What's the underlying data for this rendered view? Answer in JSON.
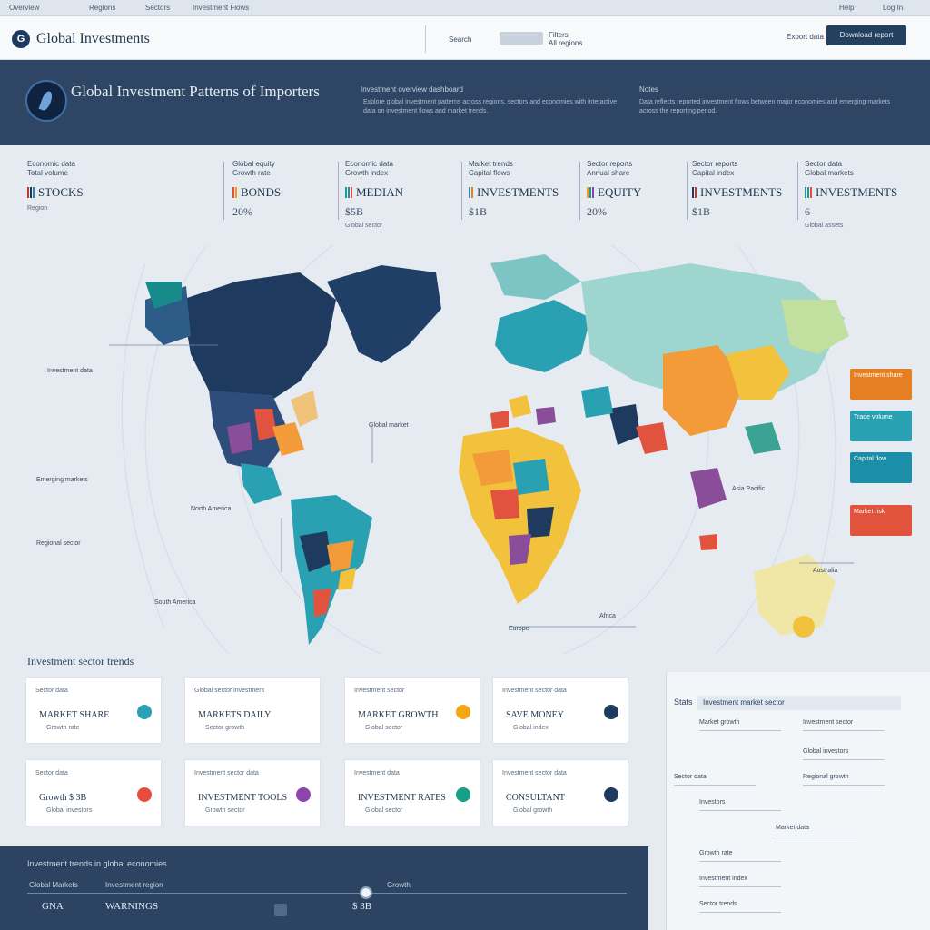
{
  "topbar": {
    "items": [
      "Overview",
      "Regions",
      "Sectors",
      "Investment Flows"
    ],
    "right": [
      "Help",
      "Log In"
    ]
  },
  "header": {
    "brand": "Global Investments",
    "nav_label": "Search",
    "field_label": "Filters",
    "field_sub": "All regions",
    "right_label": "Export data",
    "button": "Download report"
  },
  "hero": {
    "title": "Global Investment Patterns of Importers",
    "subtitle": "Investment overview dashboard",
    "description": "Explore global investment patterns across regions, sectors and economies with interactive data on investment flows and market trends.",
    "side_title": "Notes",
    "side_description": "Data reflects reported investment flows between major economies and emerging markets across the reporting period."
  },
  "stats": [
    {
      "label": "Economic data",
      "sub": "Total volume",
      "big": "STOCKS",
      "num": "",
      "small": "Region",
      "bars": [
        "#c0392b",
        "#1e3a5f",
        "#2e86ab"
      ]
    },
    {
      "label": "Global equity",
      "sub": "Growth rate",
      "big": "BONDS",
      "num": "20%",
      "small": "",
      "bars": [
        "#e74c3c",
        "#f39c12"
      ]
    },
    {
      "label": "Economic data",
      "sub": "Growth index",
      "big": "MEDIAN",
      "num": "$5B",
      "small": "Global sector",
      "bars": [
        "#16a085",
        "#2e86ab",
        "#e74c3c"
      ]
    },
    {
      "label": "Market trends",
      "sub": "Capital flows",
      "big": "INVESTMENTS",
      "num": "$1B",
      "small": "",
      "bars": [
        "#2e86ab",
        "#e67e22"
      ]
    },
    {
      "label": "Sector reports",
      "sub": "Annual share",
      "big": "EQUITY",
      "num": "20%",
      "small": "",
      "bars": [
        "#f39c12",
        "#16a085",
        "#8e44ad"
      ]
    },
    {
      "label": "Sector reports",
      "sub": "Capital index",
      "big": "INVESTMENTS",
      "num": "$1B",
      "small": "",
      "bars": [
        "#1e3a5f",
        "#c0392b"
      ]
    },
    {
      "label": "Sector data",
      "sub": "Global markets",
      "big": "INVESTMENTS",
      "num": "6",
      "small": "Global assets",
      "bars": [
        "#2e86ab",
        "#16a085",
        "#e74c3c"
      ]
    }
  ],
  "map": {
    "labels": [
      "Investment data",
      "Global market",
      "North America",
      "South America",
      "Emerging markets",
      "Asia Pacific",
      "Australia",
      "Europe",
      "Africa",
      "Regional sector"
    ]
  },
  "legend_cards": [
    {
      "label": "Investment share",
      "color": "#e67e22"
    },
    {
      "label": "Trade volume",
      "color": "#2aa1b3"
    },
    {
      "label": "Capital flow",
      "color": "#1b8fa8"
    },
    {
      "label": "Market risk",
      "color": "#e2533d"
    }
  ],
  "section": {
    "title": "Investment sector trends"
  },
  "cards": [
    {
      "label": "Sector data",
      "value": "MARKET SHARE",
      "sub": "Growth rate",
      "dot": "#2aa1b3"
    },
    {
      "label": "Global sector investment",
      "value": "MARKETS DAILY",
      "sub": "Sector growth",
      "dot": ""
    },
    {
      "label": "Investment sector",
      "value": "MARKET GROWTH",
      "sub": "Global sector",
      "dot": "#f3a712"
    },
    {
      "label": "Investment sector data",
      "value": "SAVE MONEY",
      "sub": "Global index",
      "dot": "#1e3a5f"
    },
    {
      "label": "Sector data",
      "value": "Growth $ 3B",
      "sub": "Global investors",
      "dot": "#e74c3c"
    },
    {
      "label": "Investment sector data",
      "value": "INVESTMENT TOOLS",
      "sub": "Growth sector",
      "dot": "#8e44ad"
    },
    {
      "label": "Investment data",
      "value": "INVESTMENT RATES",
      "sub": "Global sector",
      "dot": "#16a085"
    },
    {
      "label": "Investment sector data",
      "value": "CONSULTANT",
      "sub": "Global growth",
      "dot": "#1e3a5f"
    }
  ],
  "right_panel": {
    "title": "Stats",
    "heading": "Investment market sector",
    "rows": [
      "Market growth",
      "Investment sector",
      "Global investors",
      "Sector data",
      "Regional growth",
      "Investors",
      "Market data",
      "Growth rate",
      "Investment index",
      "Sector trends"
    ]
  },
  "bottom": {
    "title": "Investment trends in global economies",
    "labels": [
      "Global Markets",
      "Investment region",
      "Growth"
    ],
    "values": [
      "GNA",
      "WARNINGS",
      "$ 3B"
    ]
  }
}
